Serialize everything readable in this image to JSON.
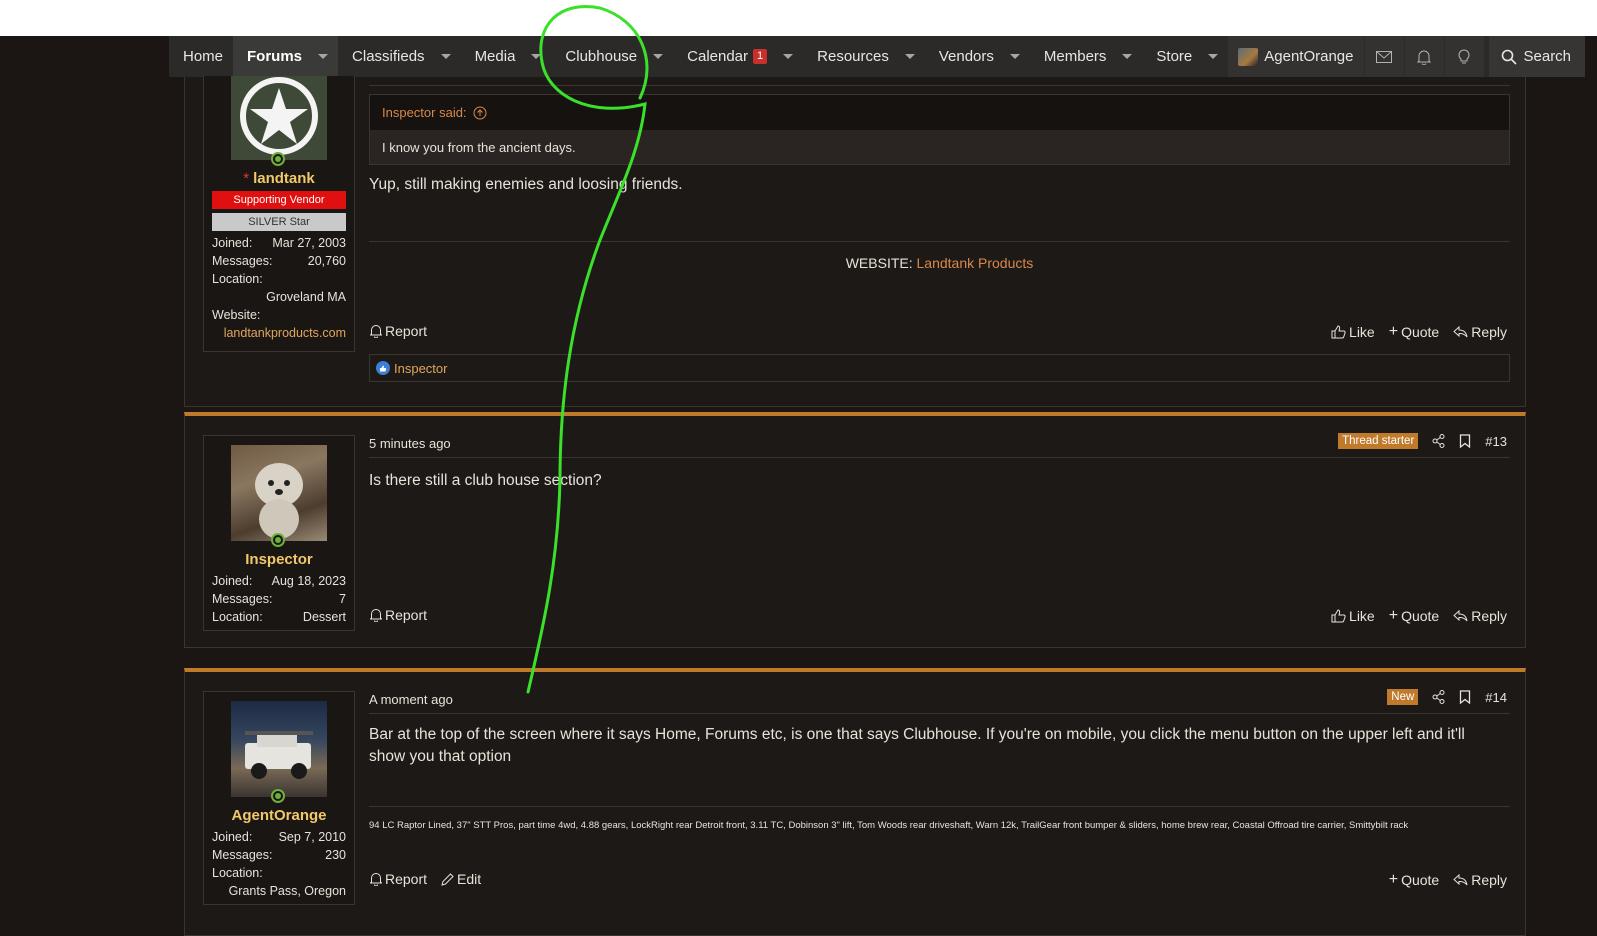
{
  "nav": {
    "items": [
      {
        "label": "Home",
        "caret": false,
        "active": false
      },
      {
        "label": "Forums",
        "caret": true,
        "active": true
      },
      {
        "label": "Classifieds",
        "caret": true,
        "active": false
      },
      {
        "label": "Media",
        "caret": true,
        "active": false
      },
      {
        "label": "Clubhouse",
        "caret": true,
        "active": false
      },
      {
        "label": "Calendar",
        "badge": "1",
        "caret": true,
        "active": false
      },
      {
        "label": "Resources",
        "caret": true,
        "active": false
      },
      {
        "label": "Vendors",
        "caret": true,
        "active": false
      },
      {
        "label": "Members",
        "caret": true,
        "active": false
      },
      {
        "label": "Store",
        "caret": true,
        "active": false
      }
    ],
    "user": "AgentOrange",
    "search_label": "Search"
  },
  "post1": {
    "user": {
      "name": "landtank",
      "banner_vendor": "Supporting Vendor",
      "banner_star": "SILVER Star",
      "joined_label": "Joined:",
      "joined": "Mar 27, 2003",
      "messages_label": "Messages:",
      "messages": "20,760",
      "location_label": "Location:",
      "location": "Groveland MA",
      "website_label": "Website:",
      "website": "landtankproducts.com"
    },
    "quote_author": "Inspector said:",
    "quote_text": "I know you from the ancient days.",
    "body": "Yup, still making enemies and loosing friends.",
    "sig_label": "WEBSITE:",
    "sig_link": "Landtank Products",
    "report": "Report",
    "like": "Like",
    "quote": "Quote",
    "reply": "Reply",
    "reaction_user": "Inspector"
  },
  "post2": {
    "user": {
      "name": "Inspector",
      "joined_label": "Joined:",
      "joined": "Aug 18, 2023",
      "messages_label": "Messages:",
      "messages": "7",
      "location_label": "Location:",
      "location": "Dessert"
    },
    "time": "5 minutes ago",
    "tag": "Thread starter",
    "number": "#13",
    "body": "Is there still a club house section?",
    "report": "Report",
    "like": "Like",
    "quote": "Quote",
    "reply": "Reply"
  },
  "post3": {
    "user": {
      "name": "AgentOrange",
      "joined_label": "Joined:",
      "joined": "Sep 7, 2010",
      "messages_label": "Messages:",
      "messages": "230",
      "location_label": "Location:",
      "location": "Grants Pass, Oregon"
    },
    "time": "A moment ago",
    "tag": "New",
    "number": "#14",
    "body": "Bar at the top of the screen where it says Home, Forums etc, is one that says Clubhouse. If you're on mobile, you click the menu button on the upper left and it'll show you that option",
    "signature": "94 LC Raptor Lined, 37\" STT Pros, part time 4wd, 4.88 gears, LockRight rear Detroit front, 3.11 TC, Dobinson 3\" lift, Tom Woods rear driveshaft, Warn 12k, TrailGear front bumper & sliders, home brew rear, Coastal Offroad tire carrier, Smittybilt rack",
    "report": "Report",
    "edit": "Edit",
    "quote": "Quote",
    "reply": "Reply"
  },
  "colors": {
    "accent": "#c07a2c",
    "annotation_stroke": "#3be02a",
    "vendor_banner": "#e01010"
  }
}
